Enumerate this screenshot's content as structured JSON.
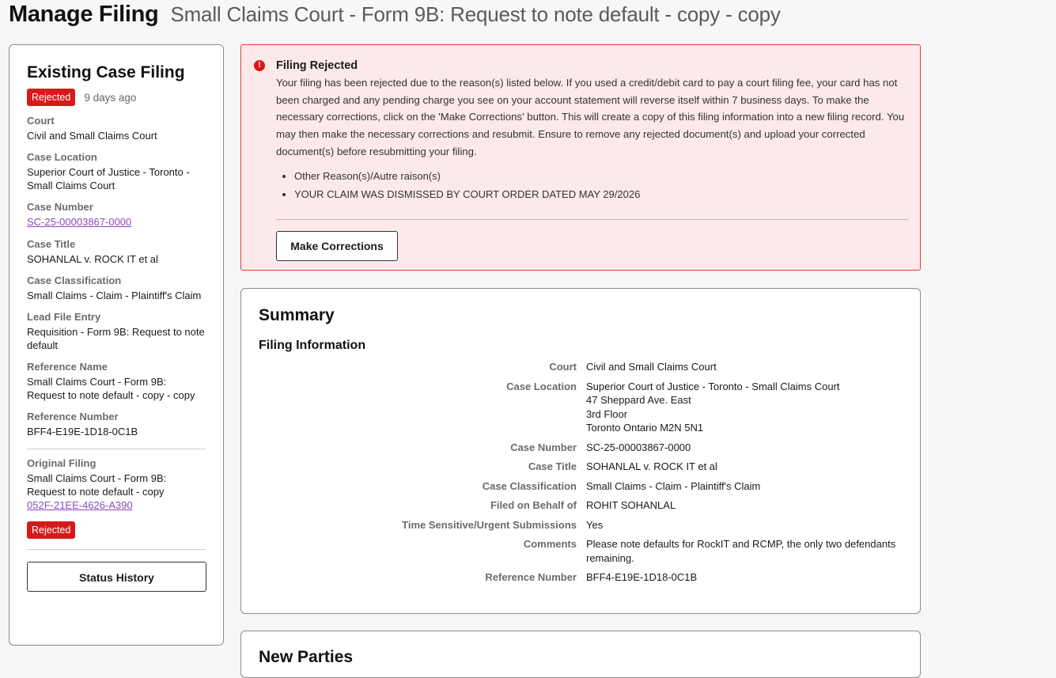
{
  "header": {
    "title": "Manage Filing",
    "subtitle": "Small Claims Court - Form 9B: Request to note default - copy - copy"
  },
  "sidebar": {
    "title": "Existing Case Filing",
    "status_badge": "Rejected",
    "status_ago": "9 days ago",
    "court_label": "Court",
    "court_value": "Civil and Small Claims Court",
    "case_location_label": "Case Location",
    "case_location_value": "Superior Court of Justice - Toronto - Small Claims Court",
    "case_number_label": "Case Number",
    "case_number_value": "SC-25-00003867-0000",
    "case_title_label": "Case Title",
    "case_title_value": "SOHANLAL v. ROCK IT et al",
    "case_classification_label": "Case Classification",
    "case_classification_value": "Small Claims - Claim - Plaintiff's Claim",
    "lead_file_label": "Lead File Entry",
    "lead_file_value": "Requisition - Form 9B: Request to note default",
    "reference_name_label": "Reference Name",
    "reference_name_value": "Small Claims Court - Form 9B: Request to note default - copy - copy",
    "reference_number_label": "Reference Number",
    "reference_number_value": "BFF4-E19E-1D18-0C1B",
    "original_filing_label": "Original Filing",
    "original_filing_value": "Small Claims Court - Form 9B: Request to note default - copy",
    "original_filing_link": "052F-21EE-4626-A390",
    "original_status_badge": "Rejected",
    "status_history_label": "Status History"
  },
  "alert": {
    "title": "Filing Rejected",
    "text": "Your filing has been rejected due to the reason(s) listed below. If you used a credit/debit card to pay a court filing fee, your card has not been charged and any pending charge you see on your account statement will reverse itself within 7 business days. To make the necessary corrections, click on the 'Make Corrections' button. This will create a copy of this filing information into a new filing record. You may then make the necessary corrections and resubmit. Ensure to remove any rejected document(s) and upload your corrected document(s) before resubmitting your filing.",
    "reasons": [
      "Other Reason(s)/Autre raison(s)",
      "YOUR CLAIM WAS DISMISSED BY COURT ORDER DATED MAY 29/2026"
    ],
    "button_label": "Make Corrections"
  },
  "summary": {
    "title": "Summary",
    "section_title": "Filing Information",
    "rows": [
      {
        "label": "Court",
        "lines": [
          "Civil and Small Claims Court"
        ]
      },
      {
        "label": "Case Location",
        "lines": [
          "Superior Court of Justice - Toronto - Small Claims Court",
          "47 Sheppard Ave. East",
          "3rd Floor",
          "Toronto Ontario M2N 5N1"
        ]
      },
      {
        "label": "Case Number",
        "lines": [
          "SC-25-00003867-0000"
        ]
      },
      {
        "label": "Case Title",
        "lines": [
          "SOHANLAL v. ROCK IT et al"
        ]
      },
      {
        "label": "Case Classification",
        "lines": [
          "Small Claims - Claim - Plaintiff's Claim"
        ]
      },
      {
        "label": "Filed on Behalf of",
        "lines": [
          "ROHIT SOHANLAL"
        ]
      },
      {
        "label": "Time Sensitive/Urgent Submissions",
        "lines": [
          "Yes"
        ]
      },
      {
        "label": "Comments",
        "lines": [
          "Please note defaults for RockIT and RCMP, the only two defendants remaining."
        ]
      },
      {
        "label": "Reference Number",
        "lines": [
          "BFF4-E19E-1D18-0C1B"
        ]
      }
    ]
  },
  "parties": {
    "title": "New Parties"
  },
  "colors": {
    "danger": "#d61a1a",
    "alert_bg": "#fde9ea",
    "link": "#8a4bb8"
  }
}
